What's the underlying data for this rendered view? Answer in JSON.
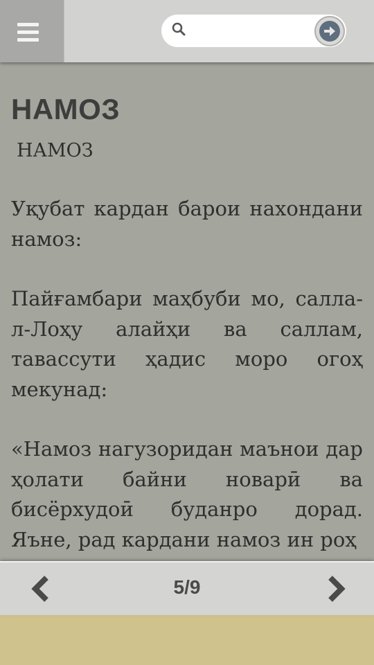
{
  "header": {
    "menu_icon": "hamburger-menu-icon",
    "search": {
      "placeholder": "",
      "value": "",
      "search_icon": "magnifier-icon",
      "go_icon": "arrow-right-circle-icon"
    }
  },
  "article": {
    "title": "НАМОЗ",
    "subtitle": "НАМОЗ",
    "paragraphs": [
      "Уқубат кардан барои нахондани намоз:",
      "Пайғамбари маҳбуби мо, салла-л-Лоҳу алайҳи ва саллам, тавассути ҳадис моро огоҳ мекунад:",
      "«Намоз нагузоридан маънои дар ҳолати байни новарӣ ва бисёрхудоӣ буданро дорад. Яъне, рад кардани намоз ин роҳ"
    ]
  },
  "pager": {
    "prev_icon": "chevron-left-icon",
    "next_icon": "chevron-right-icon",
    "indicator": "5/9",
    "current": 5,
    "total": 9
  },
  "colors": {
    "content_bg": "#a4a59c",
    "toolbar_bg": "#d2d2d0",
    "footer_bg": "#cfc28d",
    "go_button": "#5f6e7e"
  }
}
